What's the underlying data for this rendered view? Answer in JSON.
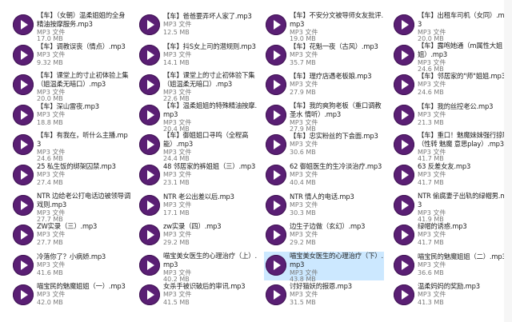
{
  "file_type": "MP3 文件",
  "icon": "audio-play-icon",
  "accent": "#5a1f74",
  "columns": [
    [
      {
        "name": "【车】（女朝）温柔姐姐的全身精油按摩服务.mp3",
        "size": "17.0 MB"
      },
      {
        "name": "【车】调教误丧（情点）.mp3",
        "size": "9.32 MB"
      },
      {
        "name": "【车】课堂上的寸止初体验上集（姐温柔无暗口）.mp3",
        "size": "20.0 MB"
      },
      {
        "name": "【车】深山雷夜.mp3",
        "size": "18.8 MB"
      },
      {
        "name": "【车】有我在，听什么主播.mp3",
        "size": "24.6 MB"
      },
      {
        "name": "25 私生饭的绑架囚禁.mp3",
        "size": "27.4 MB"
      },
      {
        "name": "NTR 边给老公打电话边被领导调戏则.mp3",
        "size": "27.7 MB"
      },
      {
        "name": "ZW实录（三）.mp3",
        "size": "27.7 MB"
      },
      {
        "name": "冷落你了？小病娇.mp3",
        "size": "41.6 MB"
      },
      {
        "name": "喵宝民的魅魔姐姐（一）.mp3",
        "size": "42.0 MB"
      }
    ],
    [
      {
        "name": "【车】爸爸要弄坏人家了.mp3",
        "size": "12.5 MB"
      },
      {
        "name": "【车】抖S女上司的潜规则.mp3",
        "size": "14.1 MB"
      },
      {
        "name": "【车】课堂上的寸止初体验下集（姐温柔无暗口）.mp3",
        "size": "22.6 MB"
      },
      {
        "name": "【车】温柔姐姐的特殊精油按摩.mp3",
        "size": "20.4 MB"
      },
      {
        "name": "【车】御姐姐口寻鸣（全程高能）.mp3",
        "size": "24.4 MB"
      },
      {
        "name": "48 邻居家的裤姐姐（三）.mp3",
        "size": "23.1 MB"
      },
      {
        "name": "NTR 老公出差以后.mp3",
        "size": "17.1 MB"
      },
      {
        "name": "zw实录（四）.mp3",
        "size": "29.2 MB"
      },
      {
        "name": "喵宝美女医生的心理治疗（上）.mp3",
        "size": "40.2 MB"
      },
      {
        "name": "女杀手被识破后的审讯.mp3",
        "size": "41.5 MB"
      }
    ],
    [
      {
        "name": "【车】不安分文被导师女友批评.mp3",
        "size": "19.0 MB"
      },
      {
        "name": "【车】花魁一夜（古风）.mp3",
        "size": "35.7 MB"
      },
      {
        "name": "【车】理疗店遇老板娘.mp3",
        "size": "27.9 MB"
      },
      {
        "name": "【车】我的爽狗老板（重口调教 圣水 情听）.mp3",
        "size": "27.9 MB"
      },
      {
        "name": "【车】忠实粉丝的下会面.mp3",
        "size": "30.6 MB"
      },
      {
        "name": "62 御姐医生的生冷淡治疗.mp3",
        "size": "40.4 MB"
      },
      {
        "name": "NTR 情人的电话.mp3",
        "size": "30.3 MB"
      },
      {
        "name": "边生子边做（玄幻）.mp3",
        "size": "29.2 MB"
      },
      {
        "name": "喵宝美女医生的心理治疗（下）.mp3",
        "size": "43.8 MB",
        "selected": true
      },
      {
        "name": "讨好猫妖的报恩.mp3",
        "size": "31.5 MB"
      }
    ],
    [
      {
        "name": "【车】出租车司机（女同）.mp3",
        "size": "20.0 MB"
      },
      {
        "name": "【车】露咆她通（m属性大姐姐）.mp3",
        "size": "24.6 MB"
      },
      {
        "name": "【车】邻居家的\"师\"姐姐.mp3",
        "size": "24.6 MB"
      },
      {
        "name": "【车】我的丝控老公.mp3",
        "size": "21.3 MB"
      },
      {
        "name": "【车】重口！魅魔妹妹强行掠取（性转 魅魔 意思play）.mp3",
        "size": "41.7 MB"
      },
      {
        "name": "63 反差女友.mp3",
        "size": "41.7 MB"
      },
      {
        "name": "NTR 偷腐妻子出轨的绿帽男.mp3",
        "size": "41.9 MB"
      },
      {
        "name": "绿帽的诱惑.mp3",
        "size": "41.7 MB"
      },
      {
        "name": "喵宝民的魅魔姐姐（二）.mp3",
        "size": "36.6 MB"
      },
      {
        "name": "温柔妈妈的奖励.mp3",
        "size": "41.3 MB"
      }
    ]
  ]
}
